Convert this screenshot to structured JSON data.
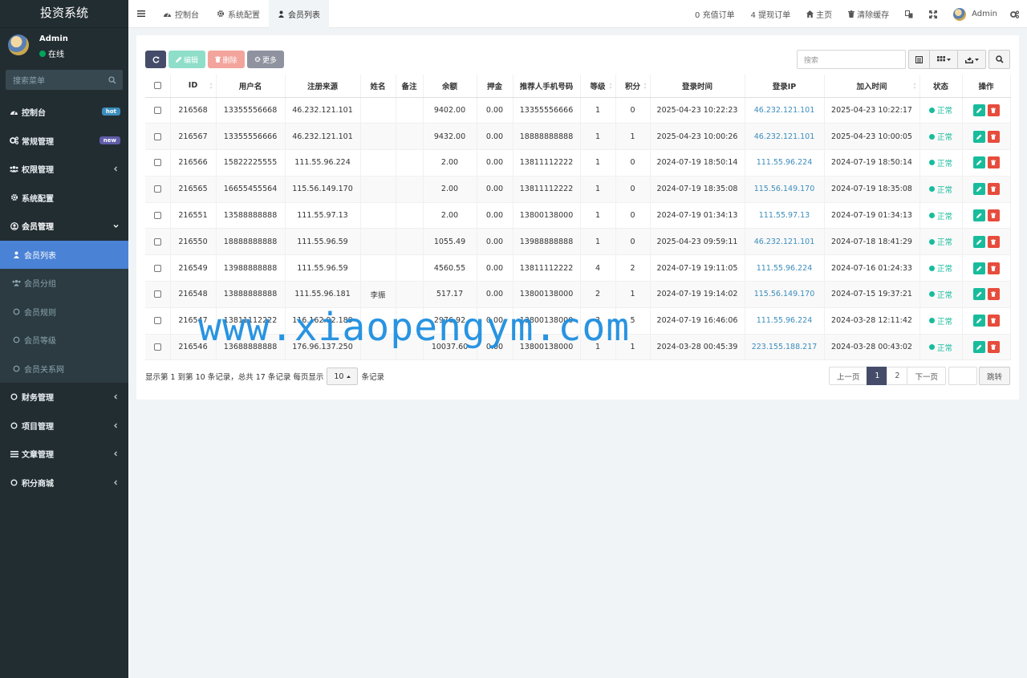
{
  "sidebar": {
    "logo": "投资系统",
    "user": {
      "name": "Admin",
      "status": "在线"
    },
    "search_placeholder": "搜索菜单",
    "menu": [
      {
        "label": "控制台",
        "badge": "hot",
        "badge_color": "#3c8dbc",
        "icon": "dashboard-icon"
      },
      {
        "label": "常规管理",
        "badge": "new",
        "badge_color": "#605ca8",
        "icon": "cogs-icon"
      },
      {
        "label": "权限管理",
        "icon": "group-icon"
      },
      {
        "label": "系统配置",
        "icon": "cog-icon"
      },
      {
        "label": "会员管理",
        "icon": "user-circle-icon"
      }
    ],
    "submenu": [
      {
        "label": "会员列表",
        "active": true
      },
      {
        "label": "会员分组"
      },
      {
        "label": "会员规则"
      },
      {
        "label": "会员等级"
      },
      {
        "label": "会员关系网"
      }
    ],
    "menu_after": [
      {
        "label": "财务管理"
      },
      {
        "label": "项目管理"
      },
      {
        "label": "文章管理"
      },
      {
        "label": "积分商城"
      }
    ]
  },
  "topbar": {
    "tabs": [
      "控制台",
      "系统配置",
      "会员列表"
    ],
    "recharge": "0 充值订单",
    "withdraw": "4 提现订单",
    "home": "主页",
    "clear_cache": "清除缓存",
    "admin": "Admin"
  },
  "toolbar": {
    "edit": "编辑",
    "delete": "删除",
    "more": "更多",
    "search_placeholder": "搜索"
  },
  "table": {
    "columns": [
      "ID",
      "用户名",
      "注册来源",
      "姓名",
      "备注",
      "余额",
      "押金",
      "推荐人手机号码",
      "等级",
      "积分",
      "登录时间",
      "登录IP",
      "加入时间",
      "状态",
      "操作"
    ],
    "rows": [
      [
        "216568",
        "13355556668",
        "46.232.121.101",
        "",
        "",
        "9402.00",
        "0.00",
        "13355556666",
        "1",
        "0",
        "2025-04-23 10:22:23",
        "46.232.121.101",
        "2025-04-23 10:22:17",
        "正常"
      ],
      [
        "216567",
        "13355556666",
        "46.232.121.101",
        "",
        "",
        "9432.00",
        "0.00",
        "18888888888",
        "1",
        "1",
        "2025-04-23 10:00:26",
        "46.232.121.101",
        "2025-04-23 10:00:05",
        "正常"
      ],
      [
        "216566",
        "15822225555",
        "111.55.96.224",
        "",
        "",
        "2.00",
        "0.00",
        "13811112222",
        "1",
        "0",
        "2024-07-19 18:50:14",
        "111.55.96.224",
        "2024-07-19 18:50:14",
        "正常"
      ],
      [
        "216565",
        "16655455564",
        "115.56.149.170",
        "",
        "",
        "2.00",
        "0.00",
        "13811112222",
        "1",
        "0",
        "2024-07-19 18:35:08",
        "115.56.149.170",
        "2024-07-19 18:35:08",
        "正常"
      ],
      [
        "216551",
        "13588888888",
        "111.55.97.13",
        "",
        "",
        "2.00",
        "0.00",
        "13800138000",
        "1",
        "0",
        "2024-07-19 01:34:13",
        "111.55.97.13",
        "2024-07-19 01:34:13",
        "正常"
      ],
      [
        "216550",
        "18888888888",
        "111.55.96.59",
        "",
        "",
        "1055.49",
        "0.00",
        "13988888888",
        "1",
        "0",
        "2025-04-23 09:59:11",
        "46.232.121.101",
        "2024-07-18 18:41:29",
        "正常"
      ],
      [
        "216549",
        "13988888888",
        "111.55.96.59",
        "",
        "",
        "4560.55",
        "0.00",
        "13811112222",
        "4",
        "2",
        "2024-07-19 19:11:05",
        "111.55.96.224",
        "2024-07-16 01:24:33",
        "正常"
      ],
      [
        "216548",
        "13888888888",
        "111.55.96.181",
        "李振",
        "",
        "517.17",
        "0.00",
        "13800138000",
        "2",
        "1",
        "2024-07-19 19:14:02",
        "115.56.149.170",
        "2024-07-15 19:37:21",
        "正常"
      ],
      [
        "216547",
        "13811112222",
        "116.162.92.189",
        "",
        "",
        "2976.92",
        "0.00",
        "13800138000",
        "3",
        "5",
        "2024-07-19 16:46:06",
        "111.55.96.224",
        "2024-03-28 12:11:42",
        "正常"
      ],
      [
        "216546",
        "13688888888",
        "176.96.137.250",
        "",
        "",
        "10037.60",
        "0.00",
        "13800138000",
        "1",
        "1",
        "2024-03-28 00:45:39",
        "223.155.188.217",
        "2024-03-28 00:43:02",
        "正常"
      ]
    ]
  },
  "footer": {
    "info": "显示第 1 到第 10 条记录，总共 17 条记录 每页显示",
    "page_size": "10",
    "info_suffix": "条记录",
    "prev": "上一页",
    "pages": [
      "1",
      "2"
    ],
    "next": "下一页",
    "jump": "跳转"
  },
  "watermark": "www.xiaopengym.com",
  "colors": {
    "sidebar": "#222d32",
    "active": "#4a82d6",
    "edit": "#18bc9c",
    "delete": "#e74c3c",
    "status": "#18bc9c",
    "ip": "#3c8dbc"
  }
}
